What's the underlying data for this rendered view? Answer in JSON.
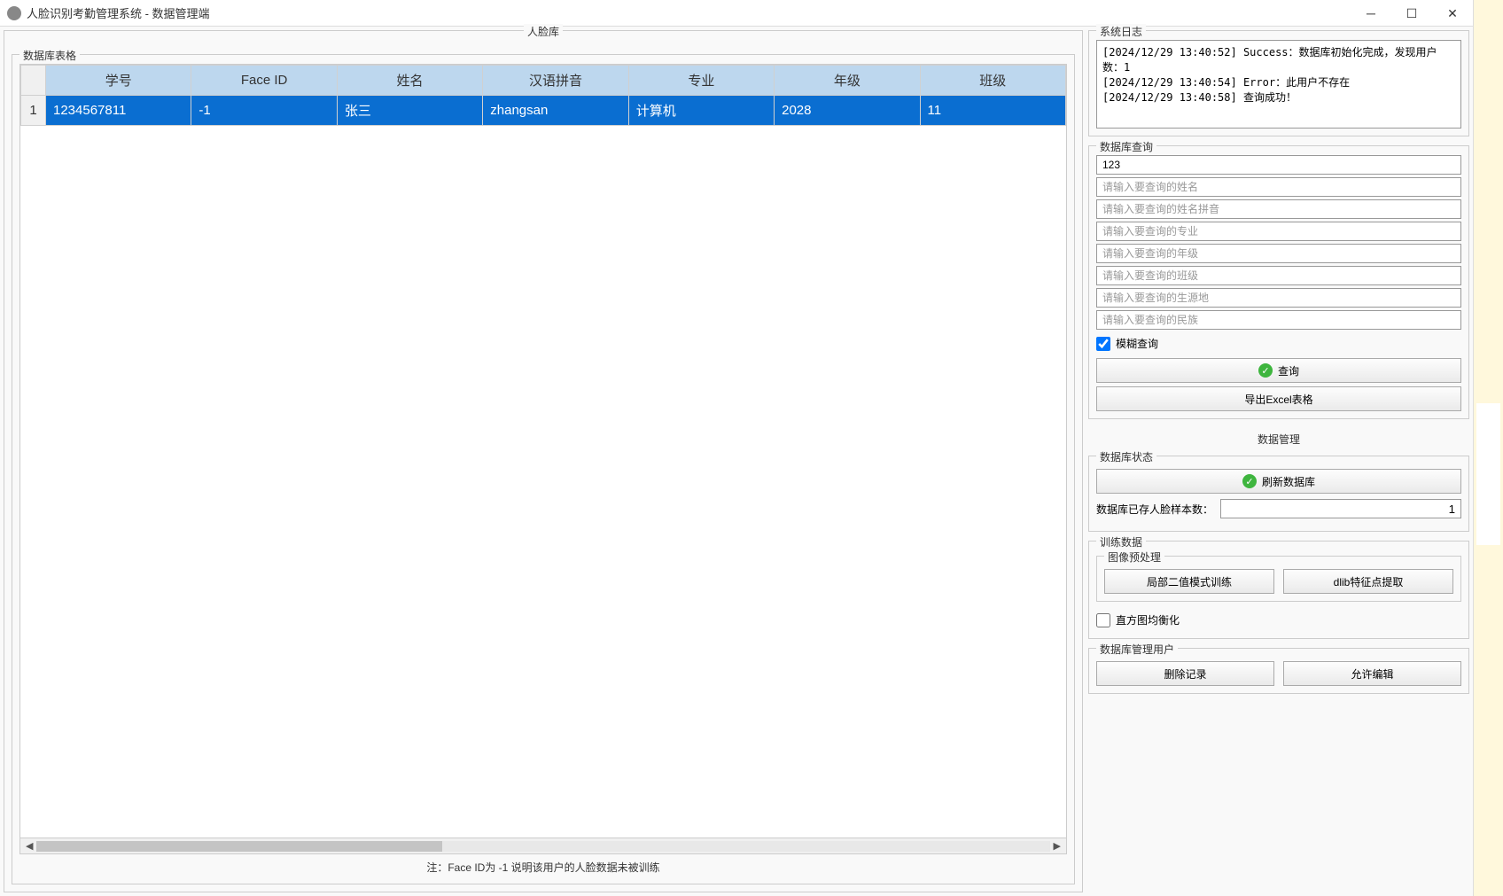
{
  "window": {
    "title": "人脸识别考勤管理系统 - 数据管理端"
  },
  "leftPane": {
    "outerLegend": "人脸库",
    "tableLegend": "数据库表格",
    "headers": [
      "学号",
      "Face ID",
      "姓名",
      "汉语拼音",
      "专业",
      "年级",
      "班级"
    ],
    "rows": [
      {
        "num": "1",
        "cells": [
          "1234567811",
          "-1",
          "张三",
          "zhangsan",
          "计算机",
          "2028",
          "11"
        ]
      }
    ],
    "note": "注：Face ID为 -1 说明该用户的人脸数据未被训练"
  },
  "log": {
    "legend": "系统日志",
    "lines": [
      "[2024/12/29 13:40:52] Success：数据库初始化完成，发现用户数：1",
      "[2024/12/29 13:40:54] Error：此用户不存在",
      "[2024/12/29 13:40:58] 查询成功！"
    ]
  },
  "query": {
    "legend": "数据库查询",
    "idValue": "123",
    "placeholders": {
      "name": "请输入要查询的姓名",
      "pinyin": "请输入要查询的姓名拼音",
      "major": "请输入要查询的专业",
      "grade": "请输入要查询的年级",
      "class": "请输入要查询的班级",
      "origin": "请输入要查询的生源地",
      "ethnic": "请输入要查询的民族"
    },
    "fuzzyLabel": "模糊查询",
    "searchBtn": "查询",
    "exportBtn": "导出Excel表格"
  },
  "manage": {
    "centerLabel": "数据管理",
    "statusLegend": "数据库状态",
    "refreshBtn": "刷新数据库",
    "countLabel": "数据库已存人脸样本数：",
    "countValue": "1"
  },
  "train": {
    "legend": "训练数据",
    "preprocLegend": "图像预处理",
    "lbpBtn": "局部二值模式训练",
    "dlibBtn": "dlib特征点提取",
    "histLabel": "直方图均衡化"
  },
  "userMgmt": {
    "legend": "数据库管理用户",
    "deleteBtn": "删除记录",
    "editBtn": "允许编辑"
  }
}
